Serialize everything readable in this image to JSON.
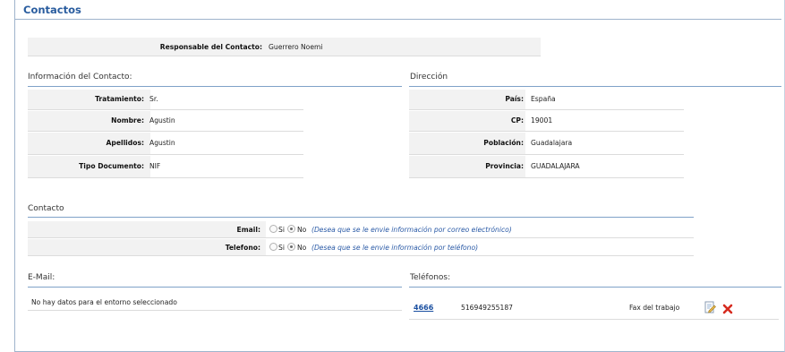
{
  "page_title": "Contactos",
  "responsable": {
    "label": "Responsable del Contacto:",
    "value": "Guerrero Noemi"
  },
  "info_contacto": {
    "title": "Información del Contacto:",
    "fields": [
      {
        "label": "Tratamiento:",
        "value": "Sr."
      },
      {
        "label": "Nombre:",
        "value": "Agustin"
      },
      {
        "label": "Apellidos:",
        "value": "Agustin"
      },
      {
        "label": "Tipo Documento:",
        "value": "NIF"
      }
    ]
  },
  "direccion": {
    "title": "Dirección",
    "fields": [
      {
        "label": "País:",
        "value": "España"
      },
      {
        "label": "CP:",
        "value": "19001"
      },
      {
        "label": "Población:",
        "value": "Guadalajara"
      },
      {
        "label": "Provincia:",
        "value": "GUADALAJARA"
      }
    ]
  },
  "contacto": {
    "title": "Contacto",
    "email": {
      "label": "Email:",
      "si": "Si",
      "no": "No",
      "selected": "No",
      "hint": "(Desea que se le envie información por correo electrónico)"
    },
    "telefono": {
      "label": "Telefono:",
      "si": "Si",
      "no": "No",
      "selected": "No",
      "hint": "(Desea que se le envie información por teléfono)"
    }
  },
  "email_section": {
    "title": "E-Mail:",
    "empty_text": "No hay datos para el entorno seleccionado"
  },
  "telefonos": {
    "title": "Teléfonos:",
    "rows": [
      {
        "id": "4666",
        "number": "516949255187",
        "type": "Fax del trabajo"
      }
    ]
  },
  "icons": {
    "edit": "edit-icon",
    "delete": "delete-icon"
  },
  "colors": {
    "accent": "#2a5d9f",
    "delete": "#d62b1f"
  }
}
